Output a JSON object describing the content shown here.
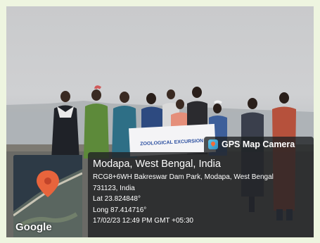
{
  "overlay": {
    "app_name": "GPS Map Camera",
    "map_attribution": "Google",
    "place": "Modapa, West Bengal, India",
    "address_line1": "RCG8+6WH Bakreswar Dam Park, Modapa, West Bengal",
    "address_line2": "731123, India",
    "latitude": "Lat 23.824848°",
    "longitude": "Long 87.414716°",
    "timestamp": "17/02/23 12:49 PM GMT +05:30"
  },
  "banner": {
    "text": "ZOOLOGICAL EXCURSION"
  },
  "icons": {
    "app_icon": "gps-map-camera-icon",
    "map_pin": "location-pin-icon"
  },
  "colors": {
    "frame": "#eef5e0",
    "overlay_bg": "#202224",
    "map_pin": "#e8643c"
  }
}
